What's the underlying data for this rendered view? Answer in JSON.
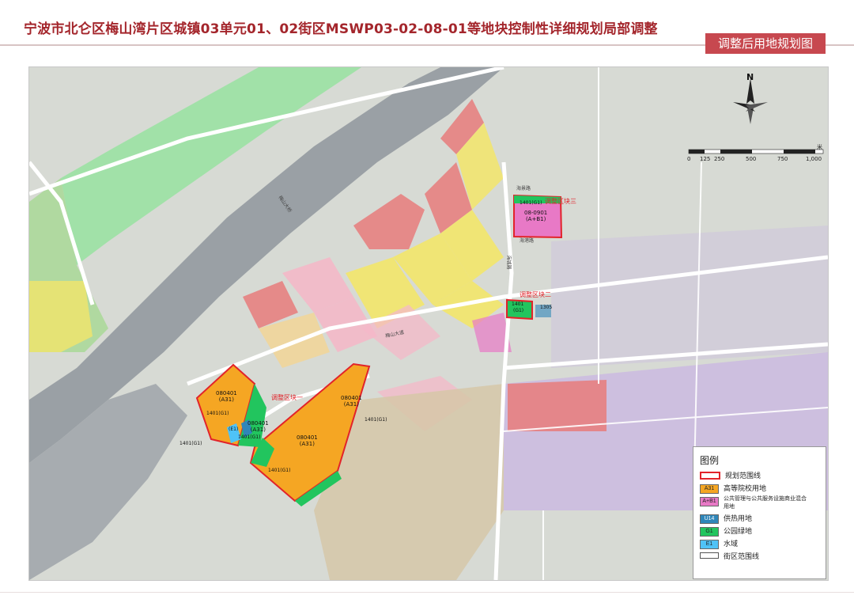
{
  "header": {
    "title": "宁波市北仑区梅山湾片区城镇03单元01、02街区MSWP03-02-08-01等地块控制性详细规划局部调整",
    "tag": "调整后用地规划图"
  },
  "map": {
    "north_label": "N",
    "scale_unit": "米",
    "scale_ticks": [
      "0",
      "125",
      "250",
      "500",
      "750",
      "1,000"
    ],
    "parcel_labels": [
      {
        "code": "080401",
        "type": "(A31)"
      },
      {
        "code": "080401",
        "type": "(A31)"
      },
      {
        "code": "080401",
        "type": "(A31)"
      },
      {
        "code": "080401",
        "type": "(A31)"
      },
      {
        "code": "08-0901",
        "type": "(A+B1)"
      }
    ],
    "small_labels": [
      "1401(G1)",
      "1401(G1)",
      "1401(G1)",
      "1401(G1)",
      "1401(G1)",
      "1401(G1)",
      "(E1)",
      "1401",
      "(G1)",
      "1305"
    ],
    "adjust_zones": [
      "调整区块一",
      "调整区块二",
      "调整区块三"
    ],
    "road_labels": [
      "梅山大桥",
      "海城路",
      "梅山大道",
      "海景路",
      "海港路"
    ]
  },
  "legend": {
    "title": "图例",
    "items": [
      {
        "code": "",
        "label": "规划范围线",
        "swatch": "#ffffff",
        "kind": "boundary"
      },
      {
        "code": "A31",
        "label": "高等院校用地",
        "swatch": "#f5a623",
        "kind": "fill"
      },
      {
        "code": "A+B1",
        "label": "公共管理与公共服务设施商业混合用地",
        "swatch": "#e879c6",
        "kind": "fill"
      },
      {
        "code": "U14",
        "label": "供热用地",
        "swatch": "#2f86b9",
        "kind": "fill"
      },
      {
        "code": "G1",
        "label": "公园绿地",
        "swatch": "#22c55e",
        "kind": "fill"
      },
      {
        "code": "E1",
        "label": "水域",
        "swatch": "#4fc3f7",
        "kind": "fill"
      },
      {
        "code": "",
        "label": "街区范围线",
        "swatch": "#ffffff",
        "kind": "street"
      }
    ]
  },
  "colors": {
    "accent": "#a4262c",
    "boundary_red": "#e2232a",
    "higher_education": "#f5a623",
    "park_green": "#22c55e",
    "water": "#4fc3f7",
    "mixed_use": "#e879c6"
  }
}
